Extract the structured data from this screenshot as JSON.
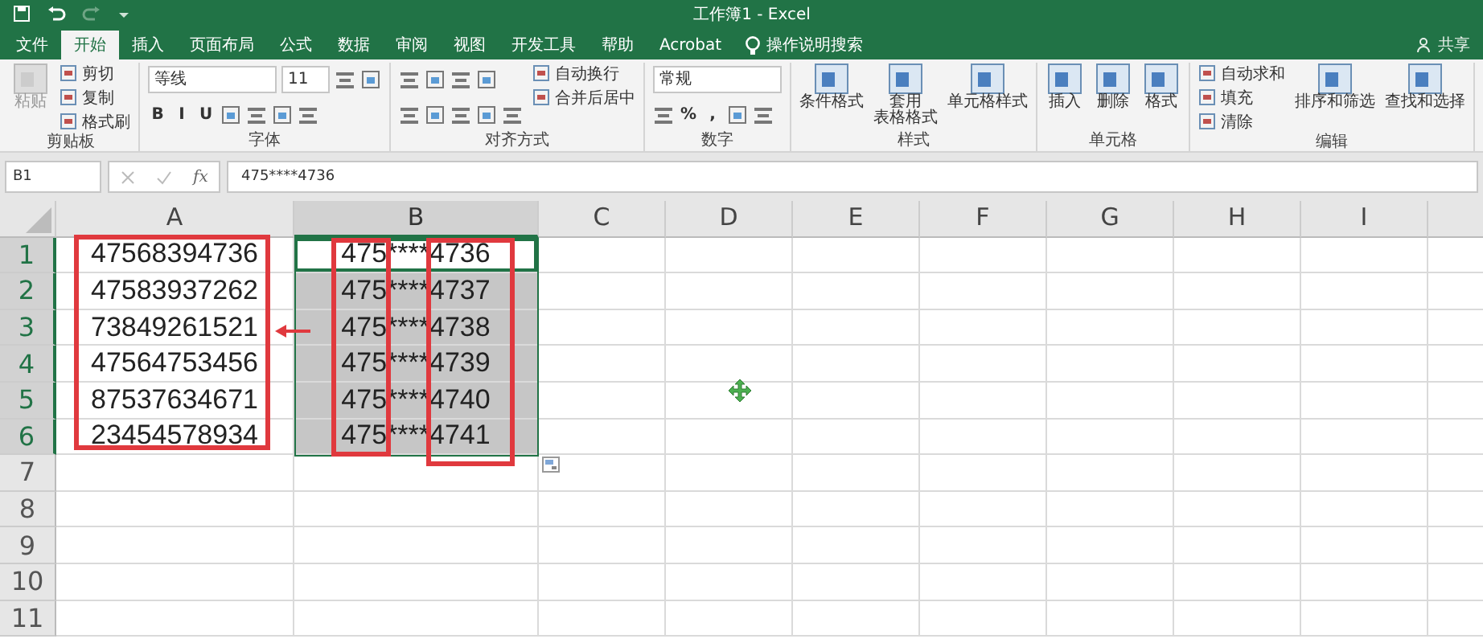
{
  "window": {
    "title": "工作簿1  -  Excel"
  },
  "tabs": [
    {
      "label": "文件",
      "selected": false
    },
    {
      "label": "开始",
      "selected": true
    },
    {
      "label": "插入",
      "selected": false
    },
    {
      "label": "页面布局",
      "selected": false
    },
    {
      "label": "公式",
      "selected": false
    },
    {
      "label": "数据",
      "selected": false
    },
    {
      "label": "审阅",
      "selected": false
    },
    {
      "label": "视图",
      "selected": false
    },
    {
      "label": "开发工具",
      "selected": false
    },
    {
      "label": "帮助",
      "selected": false
    },
    {
      "label": "Acrobat",
      "selected": false
    }
  ],
  "tell_me": {
    "placeholder": "操作说明搜索"
  },
  "share": {
    "label": "共享"
  },
  "ribbon": {
    "groups": [
      {
        "label": "剪贴板",
        "columns": [
          [
            {
              "kind": "large",
              "label": "粘贴",
              "disabled": true
            }
          ],
          [
            {
              "kind": "small",
              "label": "剪切"
            },
            {
              "kind": "small",
              "label": "复制"
            },
            {
              "kind": "small",
              "label": "格式刷"
            }
          ]
        ]
      },
      {
        "label": "字体",
        "columns": [
          [
            {
              "kind": "row",
              "items": [
                {
                  "kind": "combo",
                  "label": "等线"
                },
                {
                  "kind": "field",
                  "label": "11"
                },
                {
                  "kind": "icon"
                },
                {
                  "kind": "icon"
                }
              ]
            },
            {
              "kind": "row",
              "items": [
                {
                  "kind": "glyph",
                  "label": "B"
                },
                {
                  "kind": "glyph",
                  "label": "I"
                },
                {
                  "kind": "glyph",
                  "label": "U"
                },
                {
                  "kind": "icon"
                },
                {
                  "kind": "icon"
                },
                {
                  "kind": "icon"
                },
                {
                  "kind": "icon"
                }
              ]
            }
          ]
        ]
      },
      {
        "label": "对齐方式",
        "columns": [
          [
            {
              "kind": "row",
              "items": [
                {
                  "kind": "icon"
                },
                {
                  "kind": "icon"
                },
                {
                  "kind": "icon"
                },
                {
                  "kind": "icon"
                }
              ]
            },
            {
              "kind": "row",
              "items": [
                {
                  "kind": "icon"
                },
                {
                  "kind": "icon"
                },
                {
                  "kind": "icon"
                },
                {
                  "kind": "icon"
                },
                {
                  "kind": "icon"
                }
              ]
            }
          ],
          [
            {
              "kind": "small",
              "label": "自动换行"
            },
            {
              "kind": "small",
              "label": "合并后居中"
            }
          ]
        ]
      },
      {
        "label": "数字",
        "columns": [
          [
            {
              "kind": "row",
              "items": [
                {
                  "kind": "combo",
                  "label": "常规"
                }
              ]
            },
            {
              "kind": "row",
              "items": [
                {
                  "kind": "icon"
                },
                {
                  "kind": "glyph",
                  "label": "%"
                },
                {
                  "kind": "glyph",
                  "label": ","
                },
                {
                  "kind": "icon"
                },
                {
                  "kind": "icon"
                }
              ]
            }
          ]
        ]
      },
      {
        "label": "样式",
        "columns": [
          [
            {
              "kind": "large",
              "label": "条件格式"
            }
          ],
          [
            {
              "kind": "large",
              "lines": [
                "套用",
                "表格格式"
              ]
            }
          ],
          [
            {
              "kind": "large",
              "label": "单元格样式"
            }
          ]
        ]
      },
      {
        "label": "单元格",
        "columns": [
          [
            {
              "kind": "large",
              "label": "插入"
            }
          ],
          [
            {
              "kind": "large",
              "label": "删除"
            }
          ],
          [
            {
              "kind": "large",
              "label": "格式"
            }
          ]
        ]
      },
      {
        "label": "编辑",
        "columns": [
          [
            {
              "kind": "small",
              "label": "自动求和"
            },
            {
              "kind": "small",
              "label": "填充"
            },
            {
              "kind": "small",
              "label": "清除"
            }
          ],
          [
            {
              "kind": "large",
              "label": "排序和筛选"
            }
          ],
          [
            {
              "kind": "large",
              "label": "查找和选择"
            }
          ]
        ]
      }
    ]
  },
  "formula_bar": {
    "name_box": "B1",
    "fx": "fx",
    "formula": "475****4736"
  },
  "sheet": {
    "columns": [
      {
        "label": "A",
        "selected": false
      },
      {
        "label": "B",
        "selected": true
      },
      {
        "label": "C",
        "selected": false
      },
      {
        "label": "D",
        "selected": false
      },
      {
        "label": "E",
        "selected": false
      },
      {
        "label": "F",
        "selected": false
      },
      {
        "label": "G",
        "selected": false
      },
      {
        "label": "H",
        "selected": false
      },
      {
        "label": "I",
        "selected": false
      }
    ],
    "rows": [
      {
        "header": "1",
        "selected": true,
        "cells": [
          {
            "value": "47568394736",
            "selected": false
          },
          {
            "value": "475****4736",
            "active": true
          }
        ]
      },
      {
        "header": "2",
        "selected": true,
        "cells": [
          {
            "value": "47583937262",
            "selected": false
          },
          {
            "value": "475****4737",
            "selected": true
          }
        ]
      },
      {
        "header": "3",
        "selected": true,
        "cells": [
          {
            "value": "73849261521",
            "selected": false
          },
          {
            "value": "475****4738",
            "selected": true
          }
        ]
      },
      {
        "header": "4",
        "selected": true,
        "cells": [
          {
            "value": "47564753456",
            "selected": false
          },
          {
            "value": "475****4739",
            "selected": true
          }
        ]
      },
      {
        "header": "5",
        "selected": true,
        "cells": [
          {
            "value": "87537634671",
            "selected": false
          },
          {
            "value": "475****4740",
            "selected": true
          }
        ]
      },
      {
        "header": "6",
        "selected": true,
        "cells": [
          {
            "value": "23454578934",
            "selected": false
          },
          {
            "value": "475****4741",
            "selected": true
          }
        ]
      },
      {
        "header": "7",
        "selected": false,
        "cells": []
      },
      {
        "header": "8",
        "selected": false,
        "cells": []
      },
      {
        "header": "9",
        "selected": false,
        "cells": []
      },
      {
        "header": "10",
        "selected": false,
        "cells": []
      },
      {
        "header": "11",
        "selected": false,
        "cells": []
      }
    ]
  },
  "annotations": [
    {
      "kind": "frame"
    },
    {
      "kind": "frame"
    },
    {
      "kind": "frame"
    },
    {
      "kind": "arrow"
    }
  ]
}
